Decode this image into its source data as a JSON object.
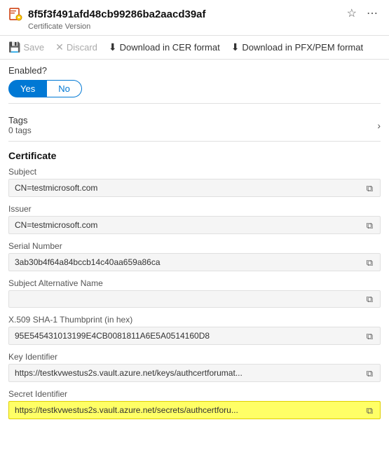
{
  "header": {
    "title": "8f5f3f491afd48cb99286ba2aacd39af",
    "subtitle": "Certificate Version",
    "pin_label": "Pin",
    "more_label": "More options"
  },
  "toolbar": {
    "save_label": "Save",
    "discard_label": "Discard",
    "download_cer_label": "Download in CER format",
    "download_pfx_label": "Download in PFX/PEM format"
  },
  "enabled": {
    "label": "Enabled?",
    "yes_label": "Yes",
    "no_label": "No",
    "active": "yes"
  },
  "tags": {
    "title": "Tags",
    "count": "0 tags"
  },
  "certificate": {
    "section_title": "Certificate",
    "subject": {
      "label": "Subject",
      "value": "CN=testmicrosoft.com"
    },
    "issuer": {
      "label": "Issuer",
      "value": "CN=testmicrosoft.com"
    },
    "serial_number": {
      "label": "Serial Number",
      "value": "3ab30b4f64a84bccb14c40aa659a86ca"
    },
    "subject_alt_name": {
      "label": "Subject Alternative Name",
      "value": ""
    },
    "thumbprint": {
      "label": "X.509 SHA-1 Thumbprint (in hex)",
      "value": "95E545431013199E4CB0081811A6E5A0514160D8"
    },
    "key_identifier": {
      "label": "Key Identifier",
      "value": "https://testkvwestus2s.vault.azure.net/keys/authcertforumat..."
    },
    "secret_identifier": {
      "label": "Secret Identifier",
      "value": "https://testkvwestus2s.vault.azure.net/secrets/authcertforu..."
    }
  }
}
